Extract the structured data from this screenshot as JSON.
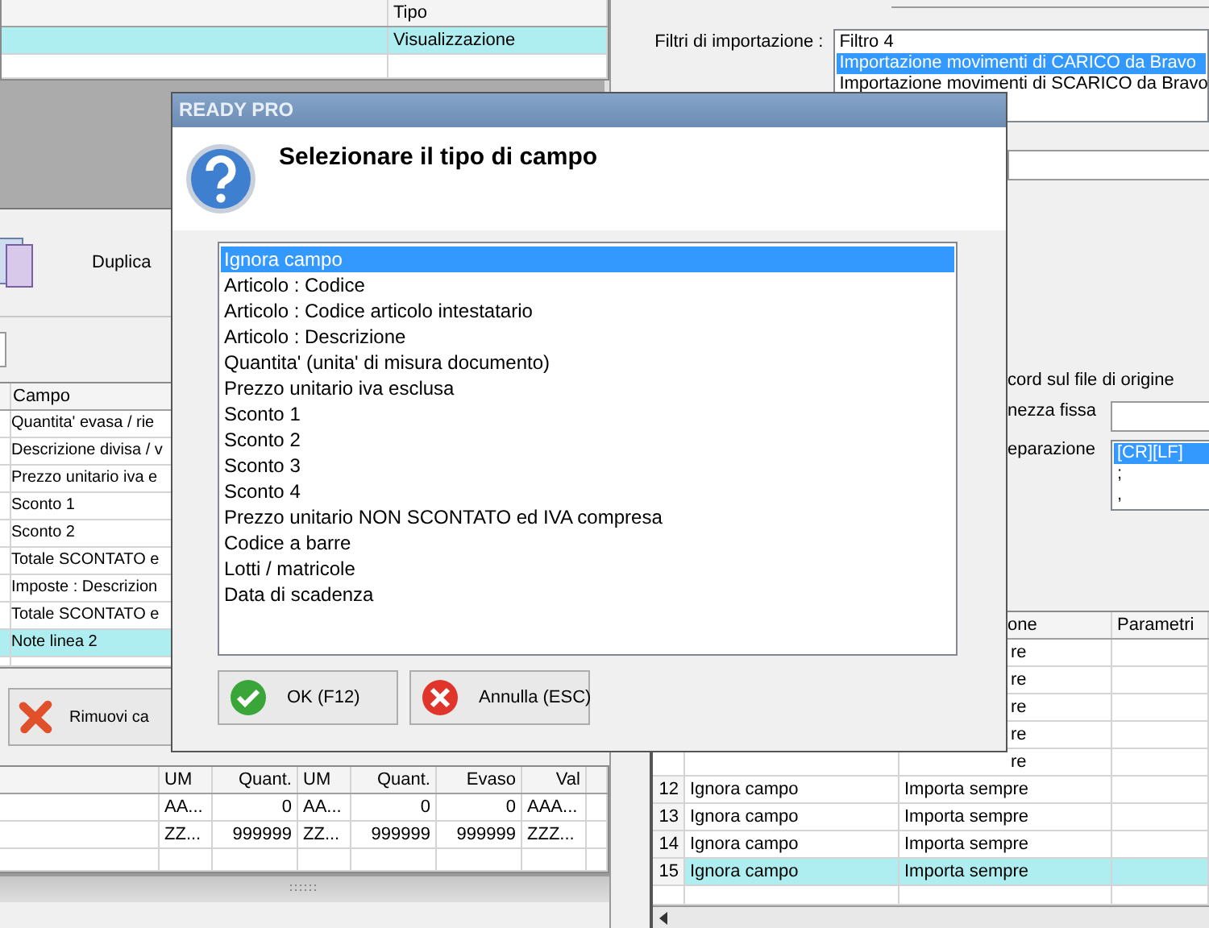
{
  "top_grid": {
    "header": "Tipo",
    "rows": [
      {
        "tipo": "Visualizzazione",
        "selected": true
      },
      {
        "selected": false
      }
    ]
  },
  "toolbar": {
    "duplicate_label": "Duplica"
  },
  "fields_grid": {
    "header": "Campo",
    "rows": [
      {
        "campo": "Quantita' evasa / rie",
        "selected": false
      },
      {
        "campo": "Descrizione divisa / v",
        "selected": false
      },
      {
        "campo": "Prezzo unitario iva e",
        "selected": false
      },
      {
        "campo": "Sconto 1",
        "selected": false
      },
      {
        "campo": "Sconto 2",
        "selected": false
      },
      {
        "campo": "Totale SCONTATO e",
        "selected": false
      },
      {
        "campo": "Imposte : Descrizion",
        "selected": false
      },
      {
        "campo": "Totale SCONTATO e",
        "selected": false
      },
      {
        "campo": "Note linea 2",
        "selected": true
      },
      {
        "selected": false
      }
    ]
  },
  "remove_button": {
    "label": "Rimuovi ca"
  },
  "bottom_grid": {
    "columns": [
      "UM",
      "Quant.",
      "UM",
      "Quant.",
      "Evaso",
      "Val"
    ],
    "rows": [
      [
        "AA...",
        "0",
        "AA...",
        "0",
        "0",
        "AAA..."
      ],
      [
        "ZZ...",
        "999999",
        "ZZ...",
        "999999",
        "999999",
        "ZZZ..."
      ]
    ]
  },
  "filters": {
    "label": "Filtri di importazione :",
    "items": [
      {
        "label": "Filtro 4",
        "selected": false
      },
      {
        "label": "Importazione movimenti di CARICO da Bravo",
        "selected": true
      },
      {
        "label": "Importazione movimenti di SCARICO da Bravo",
        "selected": false
      }
    ]
  },
  "record_group": {
    "label": "cord sul file di origine",
    "fixed_width_label": "nezza fissa",
    "separator_label": "eparazione",
    "separators": [
      {
        "label": "[CR][LF]",
        "selected": true
      },
      {
        "label": ";",
        "selected": false
      },
      {
        "label": ",",
        "selected": false
      }
    ]
  },
  "mapping_grid": {
    "columns": [
      "one",
      "Parametri"
    ],
    "rows": [
      {
        "kind": "covered",
        "azione": "re",
        "selected": false
      },
      {
        "kind": "covered",
        "azione": "re",
        "selected": false
      },
      {
        "kind": "covered",
        "azione": "re",
        "selected": false
      },
      {
        "kind": "covered",
        "azione": "re",
        "selected": false
      },
      {
        "kind": "covered",
        "azione": "re",
        "selected": false
      },
      {
        "kind": "full",
        "number": "12",
        "campo": "Ignora campo",
        "azione": "Importa sempre",
        "selected": false
      },
      {
        "kind": "full",
        "number": "13",
        "campo": "Ignora campo",
        "azione": "Importa sempre",
        "selected": false
      },
      {
        "kind": "full",
        "number": "14",
        "campo": "Ignora campo",
        "azione": "Importa sempre",
        "selected": false
      },
      {
        "kind": "full",
        "number": "15",
        "campo": "Ignora campo",
        "azione": "Importa sempre",
        "selected": true
      },
      {
        "kind": "empty",
        "selected": false
      }
    ]
  },
  "dialog": {
    "title": "READY PRO",
    "heading": "Selezionare il tipo di campo",
    "options": [
      {
        "label": "Ignora campo",
        "selected": true
      },
      {
        "label": "Articolo : Codice",
        "selected": false
      },
      {
        "label": "Articolo : Codice articolo intestatario",
        "selected": false
      },
      {
        "label": "Articolo : Descrizione",
        "selected": false
      },
      {
        "label": "Quantita' (unita' di misura documento)",
        "selected": false
      },
      {
        "label": "Prezzo unitario iva esclusa",
        "selected": false
      },
      {
        "label": "Sconto 1",
        "selected": false
      },
      {
        "label": "Sconto 2",
        "selected": false
      },
      {
        "label": "Sconto 3",
        "selected": false
      },
      {
        "label": "Sconto 4",
        "selected": false
      },
      {
        "label": "Prezzo unitario NON SCONTATO ed IVA compresa",
        "selected": false
      },
      {
        "label": "Codice a barre",
        "selected": false
      },
      {
        "label": "Lotti / matricole",
        "selected": false
      },
      {
        "label": "Data di scadenza",
        "selected": false
      }
    ],
    "ok_label": "OK (F12)",
    "cancel_label": "Annulla (ESC)"
  }
}
